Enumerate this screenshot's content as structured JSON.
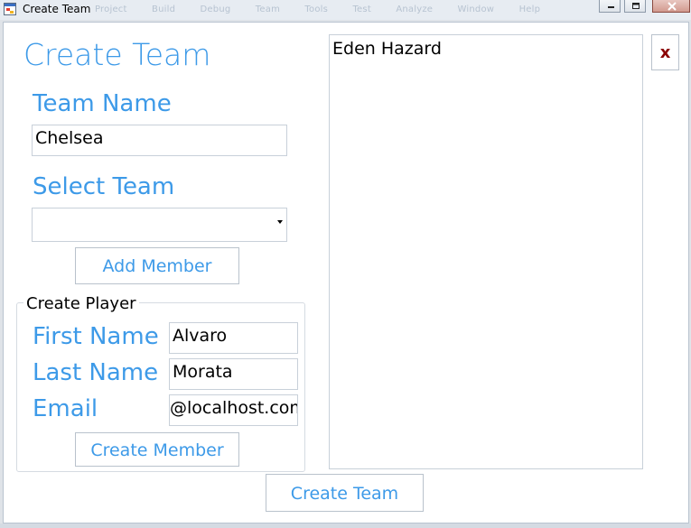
{
  "window": {
    "title": "Create Team",
    "background_menu": [
      "Project",
      "Build",
      "Debug",
      "Team",
      "Tools",
      "Test",
      "Analyze",
      "Window",
      "Help"
    ]
  },
  "form": {
    "heading": "Create Team",
    "team_name_label": "Team Name",
    "team_name_value": "Chelsea",
    "select_team_label": "Select Team",
    "select_team_value": "",
    "add_member_label": "Add Member",
    "create_team_label": "Create Team"
  },
  "player": {
    "group_label": "Create Player",
    "first_name_label": "First Name",
    "first_name_value": "Alvaro",
    "last_name_label": "Last Name",
    "last_name_value": "Morata",
    "email_label": "Email",
    "email_value": "@localhost.com",
    "create_member_label": "Create Member"
  },
  "members": {
    "items": [
      "Eden Hazard"
    ]
  },
  "close_button_label": "x",
  "colors": {
    "accent_blue": "#3d9ae8",
    "close_red": "#8b0000"
  }
}
